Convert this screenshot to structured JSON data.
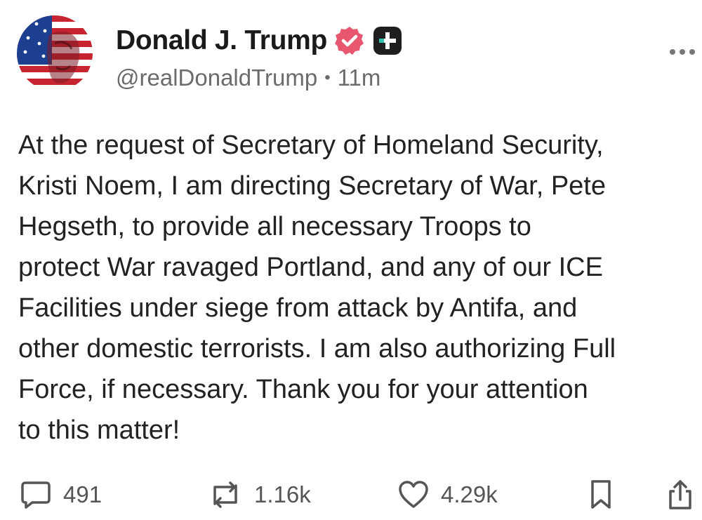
{
  "post": {
    "author": {
      "display_name": "Donald J. Trump",
      "handle": "@realDonaldTrump",
      "time_ago": "11m",
      "separator": "•"
    },
    "body": "At the request of Secretary of Homeland Security,\nKristi Noem, I am directing Secretary of War, Pete\nHegseth, to provide all necessary Troops to\nprotect War ravaged Portland, and any of our ICE\nFacilities under siege from attack by Antifa, and\nother domestic terrorists. I am also authorizing Full\nForce, if necessary. Thank you for your attention\nto this matter!",
    "actions": {
      "replies": "491",
      "reposts": "1.16k",
      "likes": "4.29k"
    }
  },
  "icons": {
    "avatar": "flag-portrait-avatar",
    "verified": "verified-badge-icon",
    "plus": "plus-badge-icon",
    "more": "more-dots-icon",
    "reply": "speech-bubble-icon",
    "repost": "repost-arrows-icon",
    "like": "heart-icon",
    "bookmark": "bookmark-icon",
    "share": "share-icon"
  },
  "colors": {
    "verified_badge": "#e8566f",
    "plus_badge": "#1f1f1f",
    "text": "#222222",
    "secondary_text": "#6b6b6b"
  }
}
